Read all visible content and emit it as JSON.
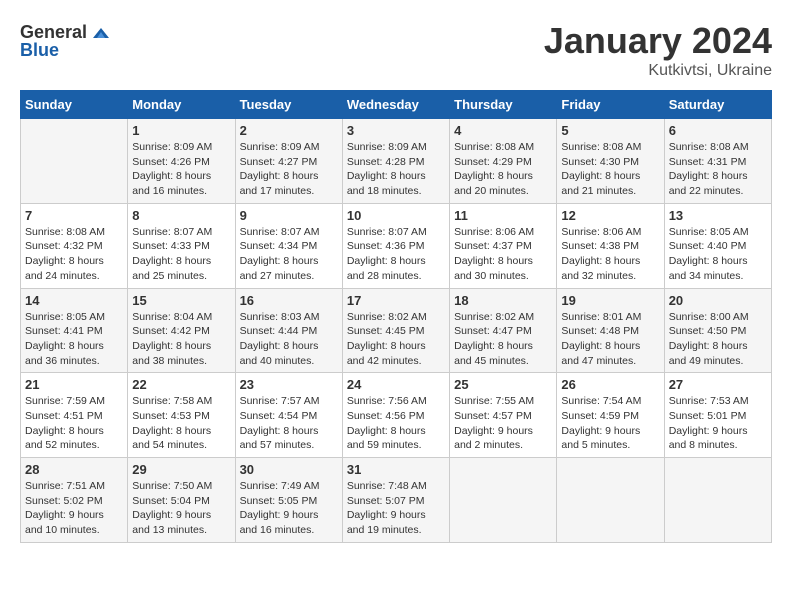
{
  "header": {
    "logo_general": "General",
    "logo_blue": "Blue",
    "month": "January 2024",
    "location": "Kutkivtsi, Ukraine"
  },
  "weekdays": [
    "Sunday",
    "Monday",
    "Tuesday",
    "Wednesday",
    "Thursday",
    "Friday",
    "Saturday"
  ],
  "weeks": [
    [
      {
        "day": "",
        "info": ""
      },
      {
        "day": "1",
        "info": "Sunrise: 8:09 AM\nSunset: 4:26 PM\nDaylight: 8 hours\nand 16 minutes."
      },
      {
        "day": "2",
        "info": "Sunrise: 8:09 AM\nSunset: 4:27 PM\nDaylight: 8 hours\nand 17 minutes."
      },
      {
        "day": "3",
        "info": "Sunrise: 8:09 AM\nSunset: 4:28 PM\nDaylight: 8 hours\nand 18 minutes."
      },
      {
        "day": "4",
        "info": "Sunrise: 8:08 AM\nSunset: 4:29 PM\nDaylight: 8 hours\nand 20 minutes."
      },
      {
        "day": "5",
        "info": "Sunrise: 8:08 AM\nSunset: 4:30 PM\nDaylight: 8 hours\nand 21 minutes."
      },
      {
        "day": "6",
        "info": "Sunrise: 8:08 AM\nSunset: 4:31 PM\nDaylight: 8 hours\nand 22 minutes."
      }
    ],
    [
      {
        "day": "7",
        "info": "Sunrise: 8:08 AM\nSunset: 4:32 PM\nDaylight: 8 hours\nand 24 minutes."
      },
      {
        "day": "8",
        "info": "Sunrise: 8:07 AM\nSunset: 4:33 PM\nDaylight: 8 hours\nand 25 minutes."
      },
      {
        "day": "9",
        "info": "Sunrise: 8:07 AM\nSunset: 4:34 PM\nDaylight: 8 hours\nand 27 minutes."
      },
      {
        "day": "10",
        "info": "Sunrise: 8:07 AM\nSunset: 4:36 PM\nDaylight: 8 hours\nand 28 minutes."
      },
      {
        "day": "11",
        "info": "Sunrise: 8:06 AM\nSunset: 4:37 PM\nDaylight: 8 hours\nand 30 minutes."
      },
      {
        "day": "12",
        "info": "Sunrise: 8:06 AM\nSunset: 4:38 PM\nDaylight: 8 hours\nand 32 minutes."
      },
      {
        "day": "13",
        "info": "Sunrise: 8:05 AM\nSunset: 4:40 PM\nDaylight: 8 hours\nand 34 minutes."
      }
    ],
    [
      {
        "day": "14",
        "info": "Sunrise: 8:05 AM\nSunset: 4:41 PM\nDaylight: 8 hours\nand 36 minutes."
      },
      {
        "day": "15",
        "info": "Sunrise: 8:04 AM\nSunset: 4:42 PM\nDaylight: 8 hours\nand 38 minutes."
      },
      {
        "day": "16",
        "info": "Sunrise: 8:03 AM\nSunset: 4:44 PM\nDaylight: 8 hours\nand 40 minutes."
      },
      {
        "day": "17",
        "info": "Sunrise: 8:02 AM\nSunset: 4:45 PM\nDaylight: 8 hours\nand 42 minutes."
      },
      {
        "day": "18",
        "info": "Sunrise: 8:02 AM\nSunset: 4:47 PM\nDaylight: 8 hours\nand 45 minutes."
      },
      {
        "day": "19",
        "info": "Sunrise: 8:01 AM\nSunset: 4:48 PM\nDaylight: 8 hours\nand 47 minutes."
      },
      {
        "day": "20",
        "info": "Sunrise: 8:00 AM\nSunset: 4:50 PM\nDaylight: 8 hours\nand 49 minutes."
      }
    ],
    [
      {
        "day": "21",
        "info": "Sunrise: 7:59 AM\nSunset: 4:51 PM\nDaylight: 8 hours\nand 52 minutes."
      },
      {
        "day": "22",
        "info": "Sunrise: 7:58 AM\nSunset: 4:53 PM\nDaylight: 8 hours\nand 54 minutes."
      },
      {
        "day": "23",
        "info": "Sunrise: 7:57 AM\nSunset: 4:54 PM\nDaylight: 8 hours\nand 57 minutes."
      },
      {
        "day": "24",
        "info": "Sunrise: 7:56 AM\nSunset: 4:56 PM\nDaylight: 8 hours\nand 59 minutes."
      },
      {
        "day": "25",
        "info": "Sunrise: 7:55 AM\nSunset: 4:57 PM\nDaylight: 9 hours\nand 2 minutes."
      },
      {
        "day": "26",
        "info": "Sunrise: 7:54 AM\nSunset: 4:59 PM\nDaylight: 9 hours\nand 5 minutes."
      },
      {
        "day": "27",
        "info": "Sunrise: 7:53 AM\nSunset: 5:01 PM\nDaylight: 9 hours\nand 8 minutes."
      }
    ],
    [
      {
        "day": "28",
        "info": "Sunrise: 7:51 AM\nSunset: 5:02 PM\nDaylight: 9 hours\nand 10 minutes."
      },
      {
        "day": "29",
        "info": "Sunrise: 7:50 AM\nSunset: 5:04 PM\nDaylight: 9 hours\nand 13 minutes."
      },
      {
        "day": "30",
        "info": "Sunrise: 7:49 AM\nSunset: 5:05 PM\nDaylight: 9 hours\nand 16 minutes."
      },
      {
        "day": "31",
        "info": "Sunrise: 7:48 AM\nSunset: 5:07 PM\nDaylight: 9 hours\nand 19 minutes."
      },
      {
        "day": "",
        "info": ""
      },
      {
        "day": "",
        "info": ""
      },
      {
        "day": "",
        "info": ""
      }
    ]
  ]
}
